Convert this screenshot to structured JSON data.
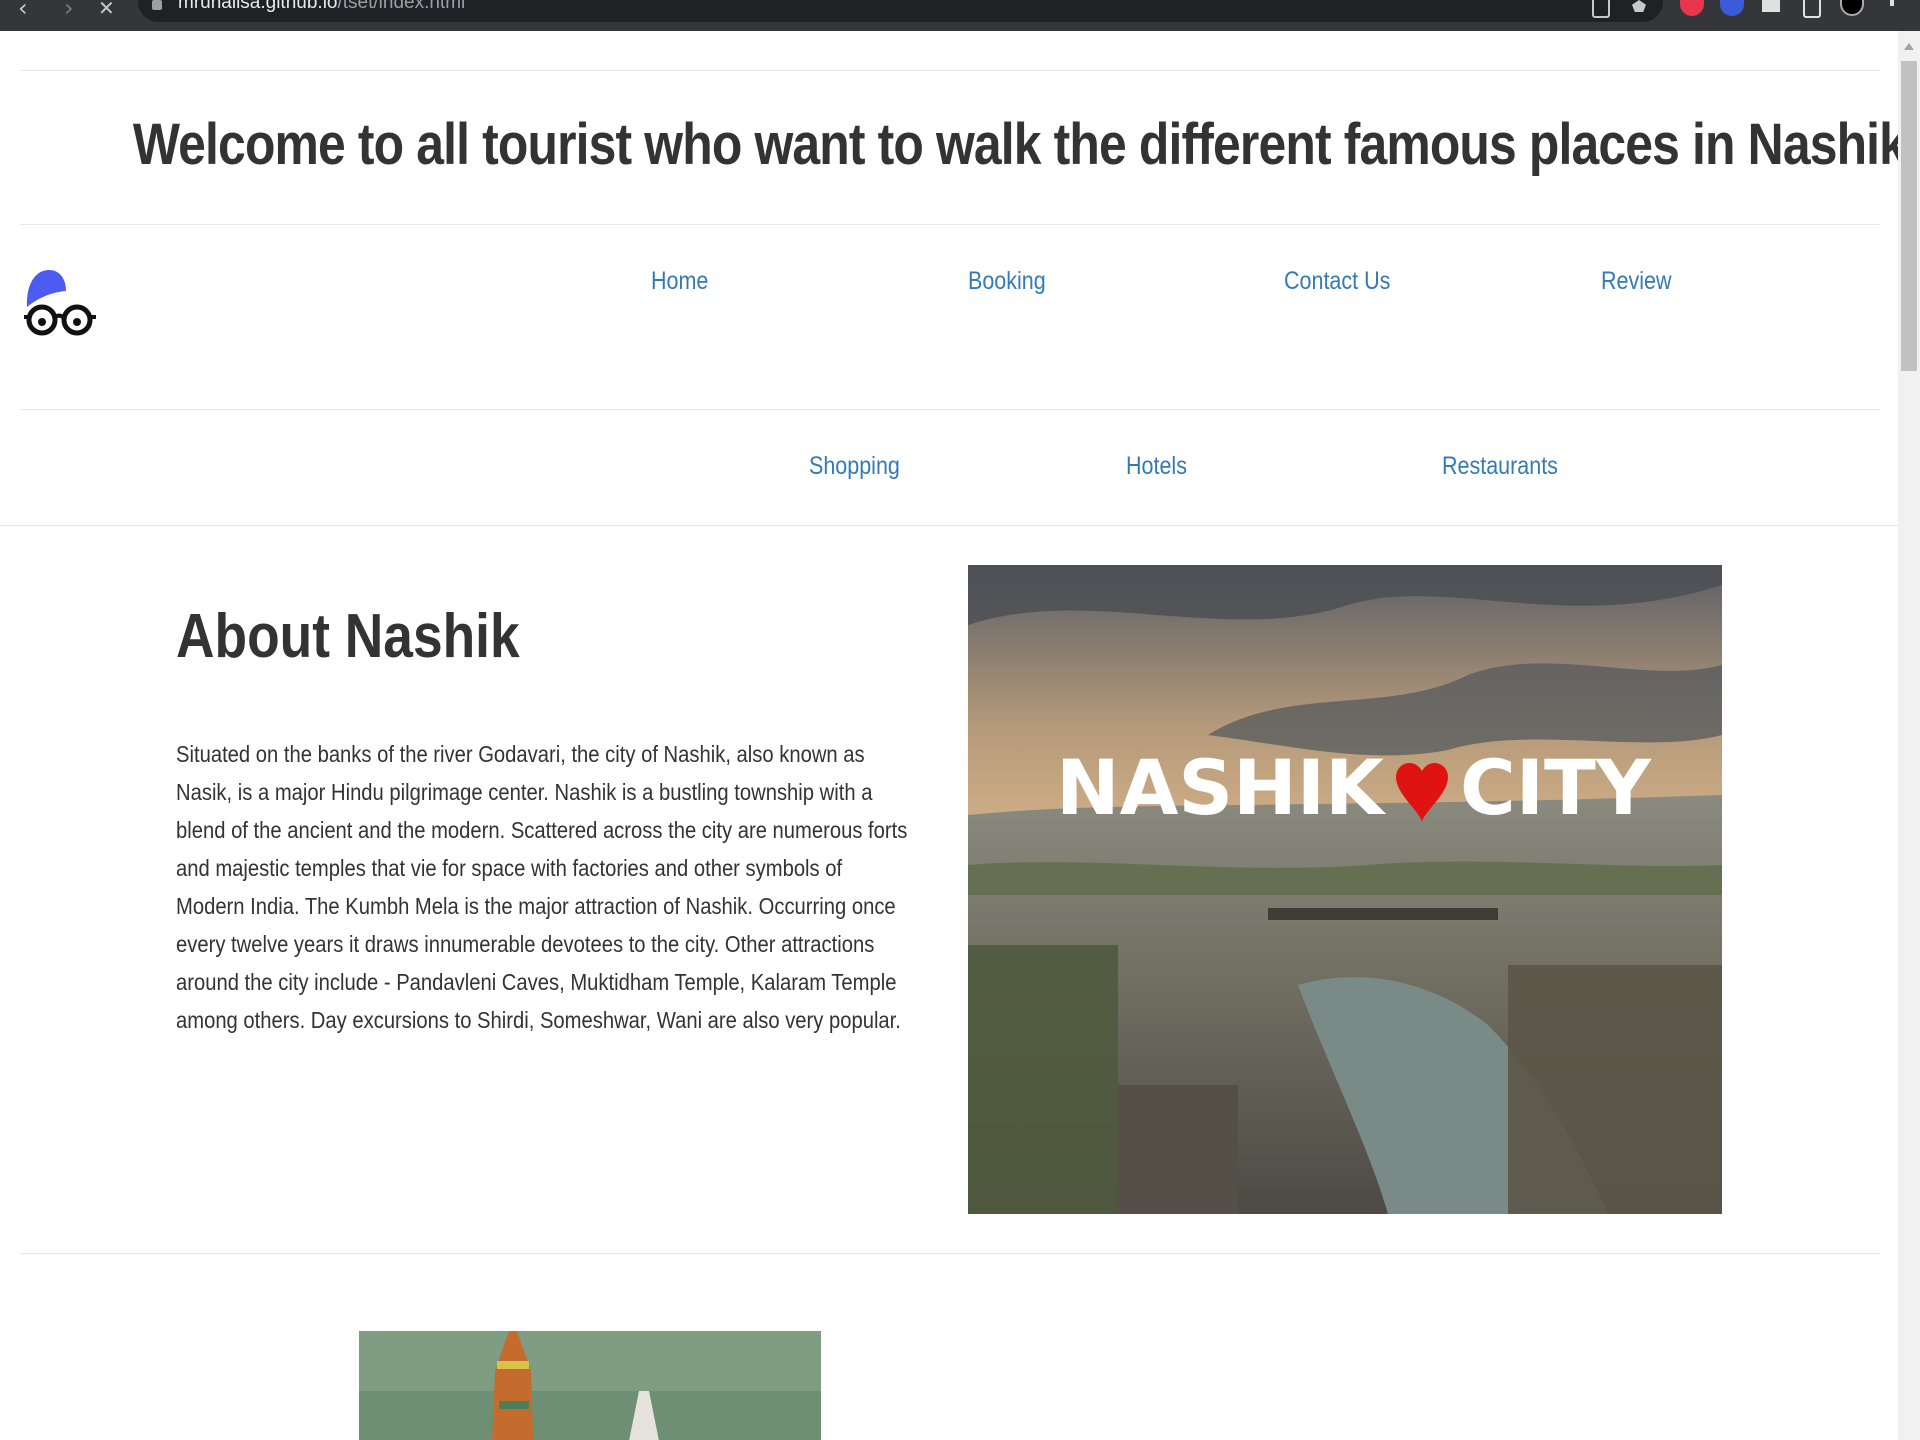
{
  "browser": {
    "url_host": "mrunalisa.github.io",
    "url_path": "/tset/index.html",
    "back_icon": "back-arrow-icon",
    "forward_icon": "forward-arrow-icon",
    "reload_icon": "stop-loading-icon"
  },
  "header": {
    "welcome_text": "Welcome to all tourist who want to walk the different famous places in Nashik"
  },
  "logo": {
    "icon": "glasses-cap-logo",
    "cap_color": "#4c5cf0"
  },
  "nav": {
    "row1": [
      {
        "label": "Home"
      },
      {
        "label": "Booking"
      },
      {
        "label": "Contact Us"
      },
      {
        "label": "Review"
      }
    ],
    "row2": [
      {
        "label": "Shopping"
      },
      {
        "label": "Hotels"
      },
      {
        "label": "Restaurants"
      }
    ],
    "link_color": "#337ab7"
  },
  "about": {
    "title": "About Nashik",
    "body": "Situated on the banks of the river Godavari, the city of Nashik, also known as Nasik, is a major Hindu pilgrimage center. Nashik is a bustling township with a blend of the ancient and the modern. Scattered across the city are numerous forts and majestic temples that vie for space with factories and other symbols of Modern India. The Kumbh Mela is the major attraction of Nashik. Occurring once every twelve years it draws innumerable devotees to the city. Other attractions around the city include - Pandavleni Caves, Muktidham Temple, Kalaram Temple among others. Day excursions to Shirdi, Someshwar, Wani are also very popular."
  },
  "hero_image": {
    "caption_left": "NASHIK",
    "caption_right": "CITY",
    "heart_icon": "heart-icon"
  },
  "second_image": {
    "content": "temple-photo"
  }
}
